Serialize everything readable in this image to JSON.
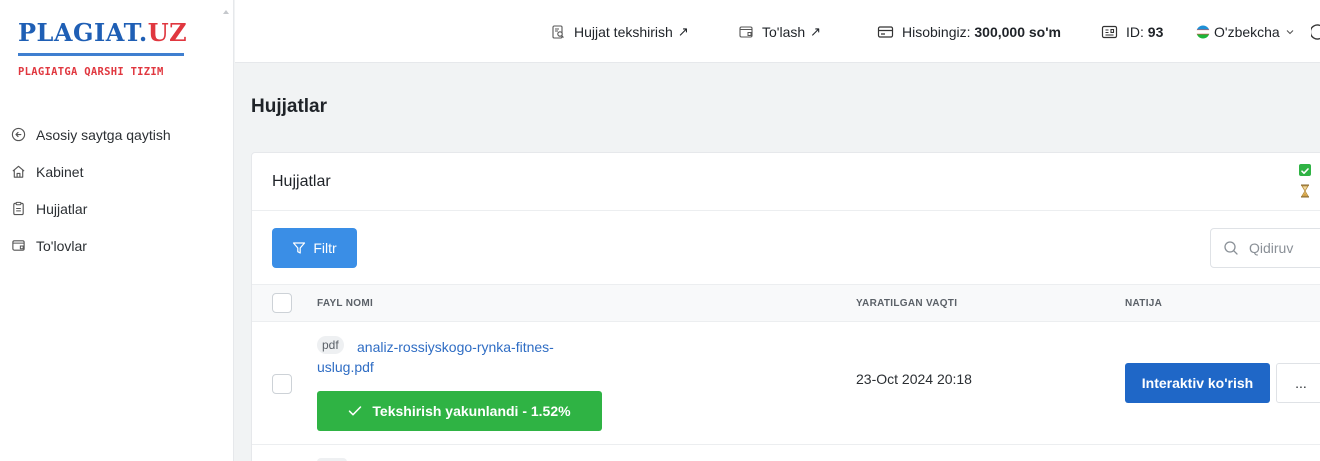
{
  "brand": {
    "title_main": "PLAGIAT.",
    "title_accent": "UZ",
    "subtitle": "PLAGIATGA QARSHI TIZIM",
    "primary_color": "#1f5fb5",
    "accent_color": "#e0373f"
  },
  "sidebar": {
    "items": [
      {
        "label": "Asosiy saytga qaytish",
        "icon": "arrow-left-circle-icon"
      },
      {
        "label": "Kabinet",
        "icon": "home-icon"
      },
      {
        "label": "Hujjatlar",
        "icon": "clipboard-icon"
      },
      {
        "label": "To'lovlar",
        "icon": "wallet-icon"
      }
    ]
  },
  "topbar": {
    "check_doc": "Hujjat tekshirish",
    "pay": "To'lash",
    "balance_label": "Hisobingiz:",
    "balance_value": "300,000 so'm",
    "id_label": "ID:",
    "id_value": "93",
    "language": "O'zbekcha"
  },
  "page": {
    "title": "Hujjatlar"
  },
  "card": {
    "title": "Hujjatlar",
    "filter_label": "Filtr",
    "search_placeholder": "Qidiruv",
    "columns": {
      "file_name": "FAYL NOMI",
      "created": "YARATILGAN VAQTI",
      "result": "NATIJA"
    },
    "rows": [
      {
        "ext": "pdf",
        "file_name": "analiz-rossiyskogo-rynka-fitnes-uslug.pdf",
        "status": "Tekshirish yakunlandi - 1.52%",
        "created": "23-Oct 2024 20:18",
        "view_label": "Interaktiv ko'rish",
        "more_label": "..."
      }
    ]
  },
  "colors": {
    "success": "#2fb344",
    "primary_button": "#1f67c7",
    "filter_button": "#3a8ee6"
  }
}
